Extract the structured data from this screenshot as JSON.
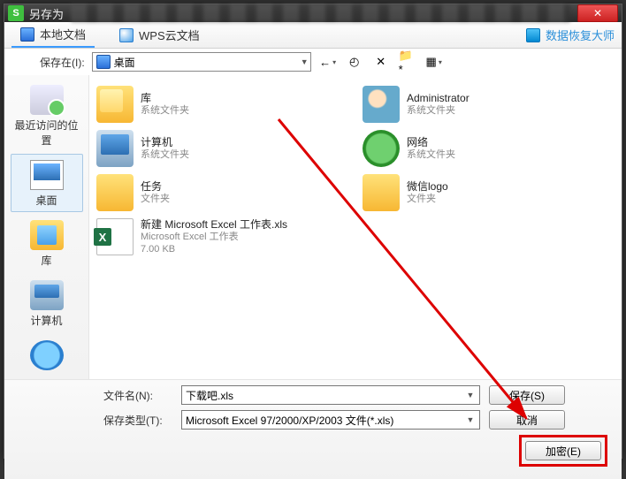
{
  "window": {
    "title": "另存为",
    "close_glyph": "✕"
  },
  "tabs": {
    "local": "本地文档",
    "cloud": "WPS云文档",
    "recover": "数据恢复大师"
  },
  "location": {
    "label": "保存在(I):",
    "value": "桌面",
    "tool_back": "←",
    "tool_up": "◴",
    "tool_del": "✕",
    "tool_new": "📁*",
    "tool_view": "▦"
  },
  "sidebar": [
    {
      "label": "最近访问的位置"
    },
    {
      "label": "桌面"
    },
    {
      "label": "库"
    },
    {
      "label": "计算机"
    },
    {
      "label": ""
    }
  ],
  "items": [
    {
      "name": "库",
      "sub": "系统文件夹"
    },
    {
      "name": "Administrator",
      "sub": "系统文件夹"
    },
    {
      "name": "计算机",
      "sub": "系统文件夹"
    },
    {
      "name": "网络",
      "sub": "系统文件夹"
    },
    {
      "name": "任务",
      "sub": "文件夹"
    },
    {
      "name": "微信logo",
      "sub": "文件夹"
    },
    {
      "name": "新建 Microsoft Excel 工作表.xls",
      "sub": "Microsoft Excel 工作表",
      "sub2": "7.00 KB"
    }
  ],
  "footer": {
    "filename_label": "文件名(N):",
    "filename_value": "下载吧.xls",
    "type_label": "保存类型(T):",
    "type_value": "Microsoft Excel 97/2000/XP/2003 文件(*.xls)",
    "save": "保存(S)",
    "cancel": "取消",
    "encrypt": "加密(E)"
  }
}
